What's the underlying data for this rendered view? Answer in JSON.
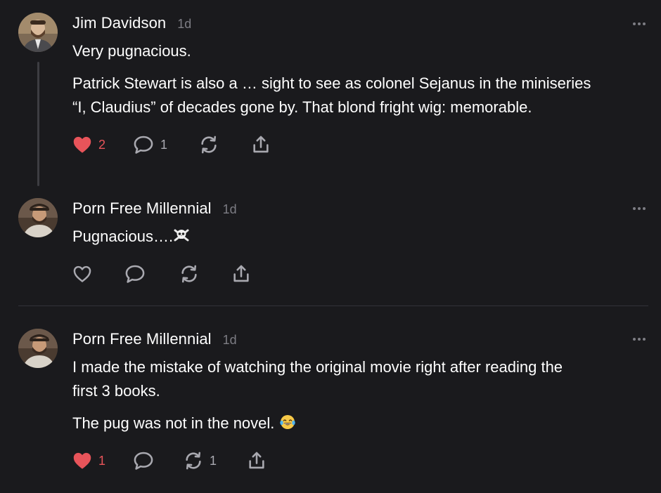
{
  "comments": [
    {
      "author": "Jim Davidson",
      "time": "1d",
      "paragraphs": [
        "Very pugnacious.",
        "Patrick Stewart is also a … sight to see as colonel Sejanus in the miniseries",
        "“I, Claudius” of decades gone by. That blond fright wig: memorable."
      ],
      "likes": "2",
      "replies": "1",
      "restacks": "",
      "liked": true
    },
    {
      "author": "Porn Free Millennial",
      "time": "1d",
      "paragraphs": [
        "Pugnacious…."
      ],
      "emoji": "skull-and-crossbones",
      "likes": "",
      "replies": "",
      "restacks": "",
      "liked": false
    },
    {
      "author": "Porn Free Millennial",
      "time": "1d",
      "paragraphs": [
        "I made the mistake of watching the original movie right after reading the",
        "first 3 books.",
        "The pug was not in the novel."
      ],
      "emoji": "tears-of-joy",
      "likes": "1",
      "replies": "",
      "restacks": "1",
      "liked": true
    }
  ],
  "colors": {
    "background": "#1a1a1d",
    "like_active": "#e8545a",
    "icon": "#a9a9b0",
    "meta": "#7d7d84"
  },
  "icons": [
    "heart-icon",
    "comment-icon",
    "restack-icon",
    "share-icon",
    "more-icon"
  ]
}
